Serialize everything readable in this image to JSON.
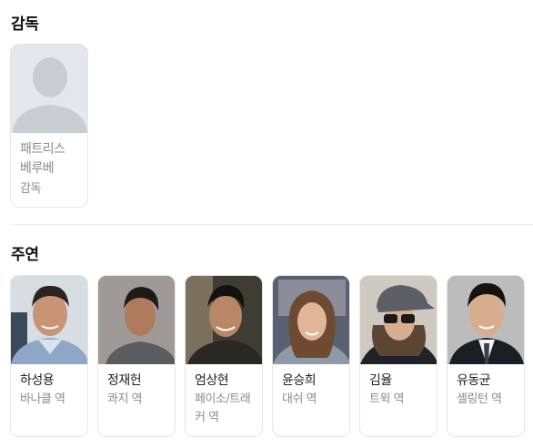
{
  "director_section": {
    "title": "감독",
    "people": [
      {
        "name": "패트리스 베루베",
        "role": "감독",
        "has_photo": false
      }
    ]
  },
  "cast_section": {
    "title": "주연",
    "people": [
      {
        "name": "하성용",
        "role": "바나클 역"
      },
      {
        "name": "정재헌",
        "role": "콰지 역"
      },
      {
        "name": "엄상현",
        "role": "페이소/트래커 역"
      },
      {
        "name": "윤승희",
        "role": "대쉬 역"
      },
      {
        "name": "김율",
        "role": "트윅 역"
      },
      {
        "name": "유동균",
        "role": "셸링턴 역"
      }
    ]
  },
  "colors": {
    "placeholder_bg": "#e5e7ec",
    "placeholder_silhouette": "#c9ccd3",
    "card_border": "#e3e6ea"
  }
}
